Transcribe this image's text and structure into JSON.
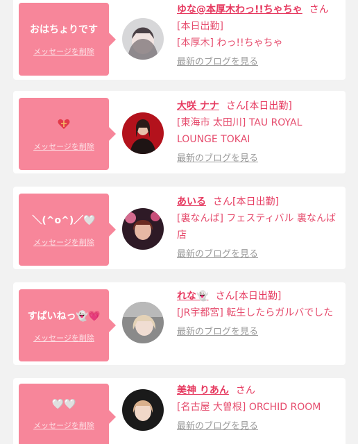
{
  "cards": [
    {
      "message": "おはちょりです",
      "delete_label": "メッセージを削除",
      "name": "ゆな@本厚木わっ!!ちゃちゃ",
      "suffix": "さん",
      "line2": "[本日出勤]",
      "shop": "[本厚木] わっ!!ちゃちゃ",
      "blog_label": "最新のブログを見る",
      "avatar_colors": [
        "#d9d9d9",
        "#7a6e73"
      ]
    },
    {
      "message": "",
      "message_icon": "heart-ribbon-icon",
      "delete_label": "メッセージを削除",
      "name": "大咲 ナナ",
      "suffix": "さん[本日出勤]",
      "shop": "[東海市 太田川] TAU ROYAL LOUNGE TOKAI",
      "blog_label": "最新のブログを見る",
      "avatar_colors": [
        "#b3121c",
        "#2b1818"
      ]
    },
    {
      "message": "＼(^o^)／🤍",
      "delete_label": "メッセージを削除",
      "name": "あいる",
      "suffix": "さん[本日出勤]",
      "shop": "[裏なんば] フェスティバル 裏なんば店",
      "blog_label": "最新のブログを見る",
      "avatar_colors": [
        "#3a1e2c",
        "#d46b8f"
      ]
    },
    {
      "message": "すぱいねっ👻💗",
      "delete_label": "メッセージを削除",
      "name": "れな👻",
      "suffix": "さん[本日出勤]",
      "shop": "[JR宇都宮] 転生したらガルバでした",
      "blog_label": "最新のブログを見る",
      "avatar_colors": [
        "#8f8f8f",
        "#e2d5c4"
      ]
    },
    {
      "message": "🤍🤍",
      "delete_label": "メッセージを削除",
      "name": "美神 りあん",
      "suffix": "さん",
      "shop": "[名古屋 大曽根] ORCHID ROOM",
      "blog_label": "最新のブログを見る",
      "avatar_colors": [
        "#1a1a1a",
        "#d9b08c"
      ]
    }
  ]
}
